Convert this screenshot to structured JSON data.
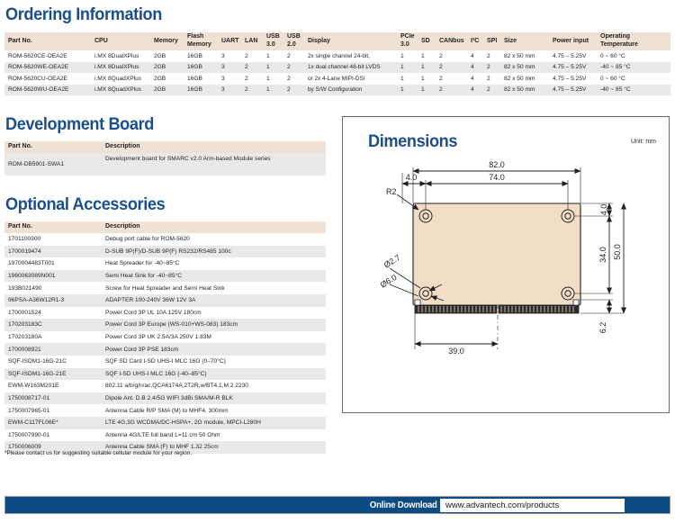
{
  "ordering": {
    "title": "Ordering Information",
    "columns": [
      "Part No.",
      "CPU",
      "Memory",
      "Flash Memory",
      "UART",
      "LAN",
      "USB 3.0",
      "USB 2.0",
      "Display",
      "PCIe 3.0",
      "SD",
      "CANbus",
      "I²C",
      "SPI",
      "Size",
      "Power input",
      "Operating Temperature"
    ],
    "rows": [
      {
        "part_no": "ROM-5620CE-OEA2E",
        "cpu": "i.MX 8DualXPlus",
        "memory": "2GB",
        "flash_memory": "16GB",
        "uart": "3",
        "lan": "2",
        "usb30": "1",
        "usb20": "2",
        "display": "2x single channel 24-bit,",
        "pcie": "1",
        "sd": "1",
        "canbus": "2",
        "i2c": "4",
        "spi": "2",
        "size": "82 x 50 mm",
        "power_input": "4.75 – 5.25V",
        "operating_temperature": "0 ~ 60 °C"
      },
      {
        "part_no": "ROM-5620WE-OEA2E",
        "cpu": "i.MX 8DualXPlus",
        "memory": "2GB",
        "flash_memory": "16GB",
        "uart": "3",
        "lan": "2",
        "usb30": "1",
        "usb20": "2",
        "display": "1x dual channel 48-bit LVDS",
        "pcie": "1",
        "sd": "1",
        "canbus": "2",
        "i2c": "4",
        "spi": "2",
        "size": "82 x 50 mm",
        "power_input": "4.75 – 5.25V",
        "operating_temperature": "-40 ~ 85 °C"
      },
      {
        "part_no": "ROM-5620CU-OEA2E",
        "cpu": "i.MX 8QuadXPlus",
        "memory": "2GB",
        "flash_memory": "16GB",
        "uart": "3",
        "lan": "2",
        "usb30": "1",
        "usb20": "2",
        "display": "or 2x 4-Lane MIPI-DSI",
        "pcie": "1",
        "sd": "1",
        "canbus": "2",
        "i2c": "4",
        "spi": "2",
        "size": "82 x 50 mm",
        "power_input": "4.75 – 5.25V",
        "operating_temperature": "0 ~ 60 °C"
      },
      {
        "part_no": "ROM-5620WU-OEA2E",
        "cpu": "i.MX 8QuadXPlus",
        "memory": "2GB",
        "flash_memory": "16GB",
        "uart": "3",
        "lan": "2",
        "usb30": "1",
        "usb20": "2",
        "display": "by S/W Configuration",
        "pcie": "1",
        "sd": "1",
        "canbus": "2",
        "i2c": "4",
        "spi": "2",
        "size": "82 x 50 mm",
        "power_input": "4.75 – 5.25V",
        "operating_temperature": "-40 ~ 85 °C"
      }
    ]
  },
  "devboard": {
    "title": "Development Board",
    "columns": [
      "Part No.",
      "Description"
    ],
    "rows": [
      {
        "part_no": "ROM-DB5901-SWA1",
        "description": "Development board for SMARC v2.0 Arm-based Module series"
      }
    ]
  },
  "accessories": {
    "title": "Optional Accessories",
    "columns": [
      "Part No.",
      "Description"
    ],
    "rows": [
      {
        "part_no": "1701100300",
        "description": "Debug port cable for ROM-5620"
      },
      {
        "part_no": "1700019474",
        "description": "D-SUB 9P(F)/D-SUB 9P(F) RS232/RS485 100c"
      },
      {
        "part_no": "1970004483T001",
        "description": "Heat Spreader for -40~85°C"
      },
      {
        "part_no": "1960063089N001",
        "description": "Semi Heat Sink for -40~85°C"
      },
      {
        "part_no": "193B021490",
        "description": "Screw for Heat Spreader and Semi Heat Sink"
      },
      {
        "part_no": "96PSA-A36W12R1-3",
        "description": "ADAPTER 100-240V 36W 12V 3A"
      },
      {
        "part_no": "1700001524",
        "description": "Power Cord 3P UL 10A 125V 180cm"
      },
      {
        "part_no": "170203183C",
        "description": "Power Cord 3P Europe (WS-010+WS-083) 183cm"
      },
      {
        "part_no": "170203180A",
        "description": "Power Cord 3P UK 2.5A/3A 250V 1.83M"
      },
      {
        "part_no": "1700008921",
        "description": "Power Cord 3P PSE 183cm"
      },
      {
        "part_no": "SQF-ISDM1-16G-21C",
        "description": "SQF SD Card I-SD UHS-I MLC 16G (0–70°C)"
      },
      {
        "part_no": "SQF-ISDM1-16G-21E",
        "description": "SQF I-SD UHS-I MLC 16G (-40–85°C)"
      },
      {
        "part_no": "EWM-W163M201E",
        "description": "802.11 a/b/g/n/ac,QCA6174A,2T2R,w/BT4.1,M.2 2230"
      },
      {
        "part_no": "1750008717-01",
        "description": "Dipole Ant. D.B 2.4/5G WIFI 3dBi SMA/M-R BLK"
      },
      {
        "part_no": "1750007965-01",
        "description": "Antenna Cable R/P SMA (M) to MHF4, 300mm"
      },
      {
        "part_no": "EWM-C117FL06E*",
        "description": "LTE 4G,3G WCDMA/DC-HSPA+, 2G module, MPCI-L280H"
      },
      {
        "part_no": "1750007990-01",
        "description": "Antenna 4G/LTE full band L=11 cm 50 Ohm"
      },
      {
        "part_no": "1750006009",
        "description": "Antenna Cable SMA (F) to MHF 1.32 25cm"
      }
    ],
    "footnote": "*Please contact us for suggesting suitable cellular module for your region."
  },
  "dimensions": {
    "title": "Dimensions",
    "unit_label": "Unit: mm",
    "labels": {
      "width_overall": "82.0",
      "width_holes": "74.0",
      "edge_offset": "4.0",
      "corner_radius": "R2",
      "hole_inner": "Ø2.7",
      "hole_outer": "Ø6.0",
      "height_overall": "50.0",
      "height_holes": "34.0",
      "top_offset": "4.0",
      "bottom_offset": "6.2",
      "connector_width": "39.0"
    }
  },
  "footer": {
    "label": "Online Download",
    "url": "www.advantech.com/products"
  },
  "colors": {
    "heading_blue": "#1a4f8b",
    "table_header_beige": "#efe2d4",
    "row_alt_gray": "#e9e9e9",
    "footer_blue": "#0d4a82",
    "board_beige": "#f2ddc6"
  }
}
